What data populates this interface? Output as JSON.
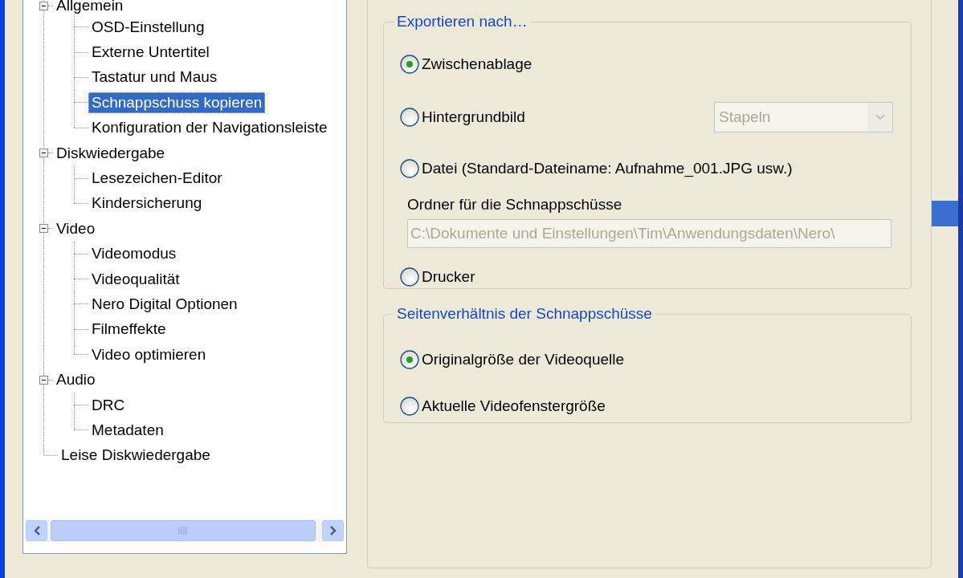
{
  "tree": {
    "items": [
      {
        "label": "Allgemein",
        "expanded": true,
        "selected": false,
        "children": [
          {
            "label": "OSD-Einstellung",
            "selected": false
          },
          {
            "label": "Externe Untertitel",
            "selected": false
          },
          {
            "label": "Tastatur und Maus",
            "selected": false
          },
          {
            "label": "Schnappschuss kopieren",
            "selected": true
          },
          {
            "label": "Konfiguration der Navigationsleiste",
            "selected": false
          }
        ]
      },
      {
        "label": "Diskwiedergabe",
        "expanded": true,
        "selected": false,
        "children": [
          {
            "label": "Lesezeichen-Editor",
            "selected": false
          },
          {
            "label": "Kindersicherung",
            "selected": false
          }
        ]
      },
      {
        "label": "Video",
        "expanded": true,
        "selected": false,
        "children": [
          {
            "label": "Videomodus",
            "selected": false
          },
          {
            "label": "Videoqualität",
            "selected": false
          },
          {
            "label": "Nero Digital Optionen",
            "selected": false
          },
          {
            "label": "Filmeffekte",
            "selected": false
          },
          {
            "label": "Video optimieren",
            "selected": false
          }
        ]
      },
      {
        "label": "Audio",
        "expanded": true,
        "selected": false,
        "children": [
          {
            "label": "DRC",
            "selected": false
          },
          {
            "label": "Metadaten",
            "selected": false
          }
        ]
      },
      {
        "label": "Leise Diskwiedergabe",
        "selected": false
      }
    ]
  },
  "export_group": {
    "title": "Exportieren nach…",
    "options": [
      {
        "label": "Zwischenablage",
        "selected": true
      },
      {
        "label": "Hintergrundbild",
        "selected": false,
        "dropdown": {
          "value": "Stapeln",
          "disabled": true
        }
      },
      {
        "label": "Datei (Standard-Dateiname: Aufnahme_001.JPG usw.)",
        "selected": false,
        "folder": {
          "label": "Ordner für die Schnappschüsse",
          "value": "C:\\Dokumente und Einstellungen\\Tim\\Anwendungsdaten\\Nero\\",
          "disabled": true
        }
      },
      {
        "label": "Drucker",
        "selected": false
      }
    ]
  },
  "aspect_group": {
    "title": "Seitenverhältnis der Schnappschüsse",
    "options": [
      {
        "label": "Originalgröße der Videoquelle",
        "selected": true
      },
      {
        "label": "Aktuelle Videofenstergröße",
        "selected": false
      }
    ]
  }
}
